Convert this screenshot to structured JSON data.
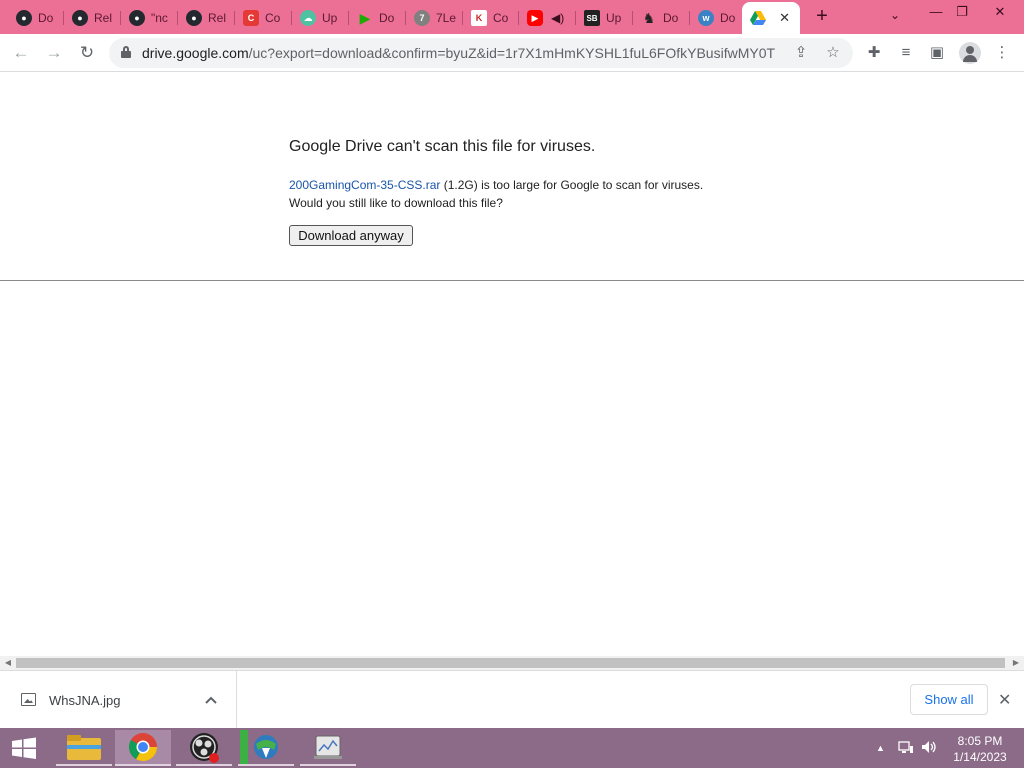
{
  "browser": {
    "tabs": [
      {
        "label": "Do",
        "icon": "github-icon",
        "color": "#24292f"
      },
      {
        "label": "Rel",
        "icon": "github-icon",
        "color": "#24292f"
      },
      {
        "label": "\"nc",
        "icon": "github-icon",
        "color": "#24292f"
      },
      {
        "label": "Rel",
        "icon": "github-icon",
        "color": "#24292f"
      },
      {
        "label": "Co",
        "icon": "red-app-icon",
        "color": "#e53935"
      },
      {
        "label": "Up",
        "icon": "cloud-icon",
        "color": "#4fc3a1"
      },
      {
        "label": "Do",
        "icon": "play-icon",
        "color": "#1faa00"
      },
      {
        "label": "7Le",
        "icon": "grey-app-icon",
        "color": "#808080"
      },
      {
        "label": "Co",
        "icon": "k-icon",
        "color": "#ffffff"
      },
      {
        "label": "",
        "icon": "youtube-icon",
        "color": "#ff0000"
      },
      {
        "label": "Up",
        "icon": "sb-icon",
        "color": "#222222"
      },
      {
        "label": "Do",
        "icon": "chess-icon",
        "color": "#333333"
      },
      {
        "label": "Do",
        "icon": "wp-icon",
        "color": "#3b82c4"
      }
    ],
    "active_tab": {
      "icon": "google-drive-icon",
      "close": "✕"
    },
    "new_tab": "+",
    "tab_search": "⌄",
    "window_controls": {
      "minimize": "—",
      "restore": "❐",
      "close": "✕"
    },
    "url_host": "drive.google.com",
    "url_path": "/uc?export=download&confirm=byuZ&id=1r7X1mHmKYSHL1fuL6FOfkYBusifwMY0T"
  },
  "page": {
    "heading": "Google Drive can't scan this file for viruses.",
    "file_link": "200GamingCom-35-CSS.rar",
    "file_size": " (1.2G)",
    "message_tail": " is too large for Google to scan for viruses.",
    "question": "Would you still like to download this file?",
    "download_button": "Download anyway"
  },
  "download_shelf": {
    "file_name": "WhsJNA.jpg",
    "caret": "^",
    "show_all": "Show all",
    "close": "✕"
  },
  "taskbar": {
    "time": "8:05 PM",
    "date": "1/14/2023",
    "tray_up": "▲"
  },
  "colors": {
    "tabstrip": "#ec6f95",
    "taskbar": "#8b6b88",
    "link": "#1a55a8",
    "accent": "#1a73e8"
  }
}
